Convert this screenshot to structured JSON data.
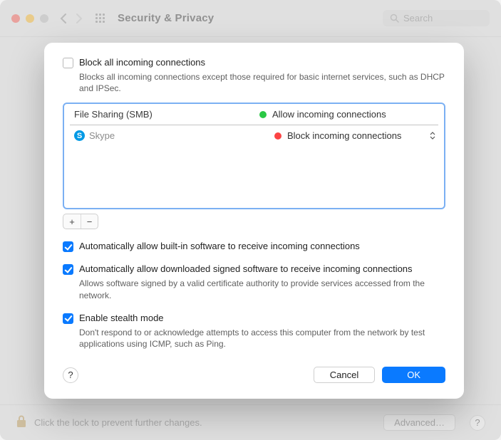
{
  "toolbar": {
    "title": "Security & Privacy",
    "search_placeholder": "Search"
  },
  "sheet": {
    "block_all": {
      "label": "Block all incoming connections",
      "desc": "Blocks all incoming connections except those required for basic internet services, such as DHCP and IPSec.",
      "checked": false
    },
    "apps": [
      {
        "name": "File Sharing (SMB)",
        "status_label": "Allow incoming connections",
        "status_color": "green",
        "has_icon": false,
        "muted": false,
        "has_dropdown": false
      },
      {
        "name": "Skype",
        "status_label": "Block incoming connections",
        "status_color": "red",
        "has_icon": true,
        "muted": true,
        "has_dropdown": true
      }
    ],
    "add_label": "+",
    "remove_label": "−",
    "auto_builtin": {
      "label": "Automatically allow built-in software to receive incoming connections",
      "checked": true
    },
    "auto_signed": {
      "label": "Automatically allow downloaded signed software to receive incoming connections",
      "desc": "Allows software signed by a valid certificate authority to provide services accessed from the network.",
      "checked": true
    },
    "stealth": {
      "label": "Enable stealth mode",
      "desc": "Don't respond to or acknowledge attempts to access this computer from the network by test applications using ICMP, such as Ping.",
      "checked": true
    },
    "help_label": "?",
    "cancel_label": "Cancel",
    "ok_label": "OK"
  },
  "footer": {
    "lock_text": "Click the lock to prevent further changes.",
    "advanced_label": "Advanced…",
    "help_label": "?"
  }
}
